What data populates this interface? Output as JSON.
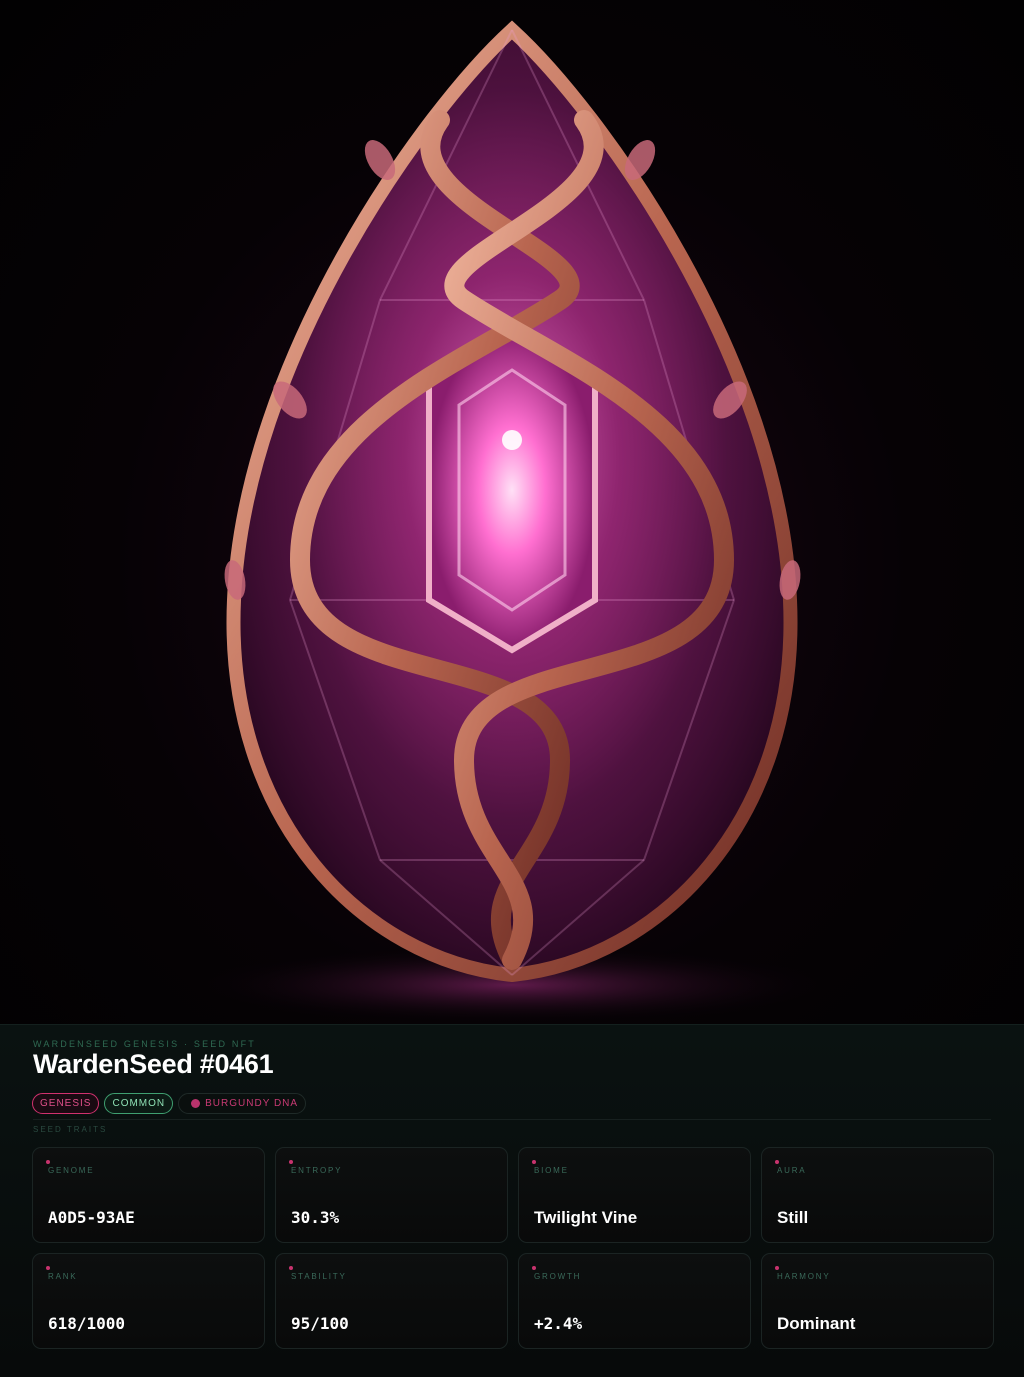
{
  "hero": {
    "image_subject": "faceted-pink-crystal-seed-with-rose-gold-vines"
  },
  "header": {
    "eyebrow": "WARDENSEED GENESIS · SEED NFT",
    "title": "WardenSeed #0461"
  },
  "badges": [
    {
      "label": "GENESIS",
      "color": "#d0316e"
    },
    {
      "label": "COMMON",
      "color": "#3f9f70"
    },
    {
      "label": "BURGUNDY DNA",
      "color": "#b8336c"
    }
  ],
  "traits_section_label": "SEED TRAITS",
  "traits": [
    {
      "label": "GENOME",
      "value": "A0D5-93AE"
    },
    {
      "label": "ENTROPY",
      "value": "30.3%"
    },
    {
      "label": "BIOME",
      "value": "Twilight Vine"
    },
    {
      "label": "AURA",
      "value": "Still"
    },
    {
      "label": "RANK",
      "value": "618/1000"
    },
    {
      "label": "STABILITY",
      "value": "95/100"
    },
    {
      "label": "GROWTH",
      "value": "+2.4%"
    },
    {
      "label": "HARMONY",
      "value": "Dominant"
    }
  ]
}
